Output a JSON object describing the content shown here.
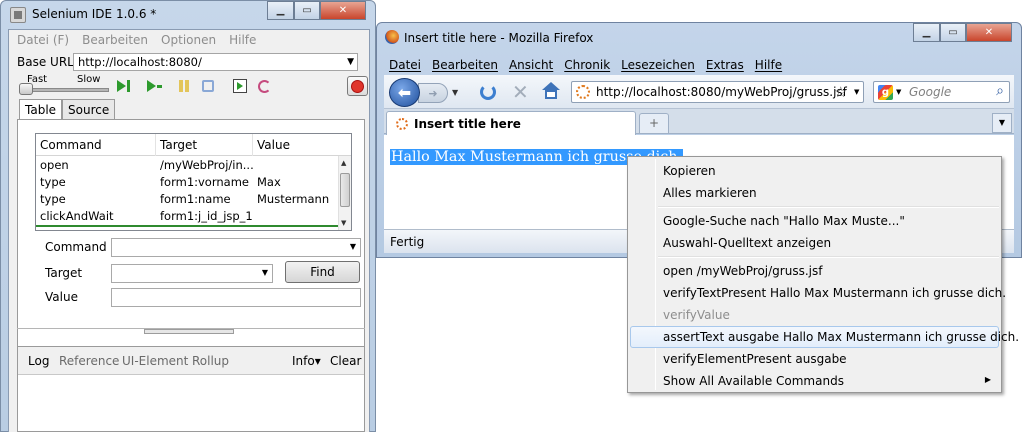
{
  "selenium": {
    "title": "Selenium IDE 1.0.6 *",
    "menu": [
      "Datei (F)",
      "Bearbeiten",
      "Optionen",
      "Hilfe"
    ],
    "base_url_label": "Base URL",
    "base_url_value": "http://localhost:8080/",
    "speed_fast": "Fast",
    "speed_slow": "Slow",
    "tabs": [
      "Table",
      "Source"
    ],
    "columns": [
      "Command",
      "Target",
      "Value"
    ],
    "rows": [
      {
        "command": "open",
        "target": "/myWebProj/in...",
        "value": ""
      },
      {
        "command": "type",
        "target": "form1:vorname",
        "value": "Max"
      },
      {
        "command": "type",
        "target": "form1:name",
        "value": "Mustermann"
      },
      {
        "command": "clickAndWait",
        "target": "form1:j_id_jsp_1...",
        "value": ""
      }
    ],
    "command_label": "Command",
    "target_label": "Target",
    "value_label": "Value",
    "find_label": "Find",
    "log_tabs": [
      "Log",
      "Reference",
      "UI-Element",
      "Rollup"
    ],
    "info_label": "Info▾",
    "clear_label": "Clear",
    "icons": [
      "speed-slider-icon",
      "play-all-icon",
      "play-current-icon",
      "pause-icon",
      "step-icon",
      "testrunner-icon",
      "schedule-icon",
      "record-icon"
    ]
  },
  "firefox": {
    "title": "Insert title here - Mozilla Firefox",
    "menu": [
      "Datei",
      "Bearbeiten",
      "Ansicht",
      "Chronik",
      "Lesezeichen",
      "Extras",
      "Hilfe"
    ],
    "url": "http://localhost:8080/myWebProj/gruss.jsf",
    "search_placeholder": "Google",
    "tab_title": "Insert title here",
    "page_text": "Hallo Max Mustermann ich grusse dich.",
    "status": "Fertig",
    "selection_color": "#3399ff"
  },
  "context_menu": {
    "items": [
      {
        "label": "Kopieren"
      },
      {
        "label": "Alles markieren"
      },
      {
        "label": "Google-Suche nach \"Hallo Max Muste...\""
      },
      {
        "label": "Auswahl-Quelltext anzeigen"
      },
      {
        "label": "open /myWebProj/gruss.jsf"
      },
      {
        "label": "verifyTextPresent Hallo Max Mustermann ich grusse dich."
      },
      {
        "label": "verifyValue"
      },
      {
        "label": "assertText ausgabe Hallo Max Mustermann ich grusse dich."
      },
      {
        "label": "verifyElementPresent ausgabe"
      },
      {
        "label": "Show All Available Commands"
      }
    ]
  }
}
